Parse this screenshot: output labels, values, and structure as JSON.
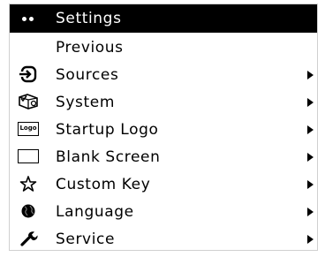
{
  "menu": {
    "header": {
      "title": "Settings"
    },
    "items": [
      {
        "label": "Previous",
        "icon": "none",
        "has_submenu": false
      },
      {
        "label": "Sources",
        "icon": "input-source-icon",
        "has_submenu": true
      },
      {
        "label": "System",
        "icon": "system-icon",
        "has_submenu": true
      },
      {
        "label": "Startup Logo",
        "icon": "logo-icon",
        "icon_text": "Logo",
        "has_submenu": true
      },
      {
        "label": "Blank Screen",
        "icon": "blank-screen-icon",
        "has_submenu": true
      },
      {
        "label": "Custom Key",
        "icon": "star-icon",
        "has_submenu": true
      },
      {
        "label": "Language",
        "icon": "globe-icon",
        "has_submenu": true
      },
      {
        "label": "Service",
        "icon": "wrench-icon",
        "has_submenu": true
      }
    ]
  },
  "colors": {
    "header_background": "#000000",
    "header_text": "#ffffff",
    "menu_background": "#ffffff",
    "menu_text": "#000000"
  }
}
